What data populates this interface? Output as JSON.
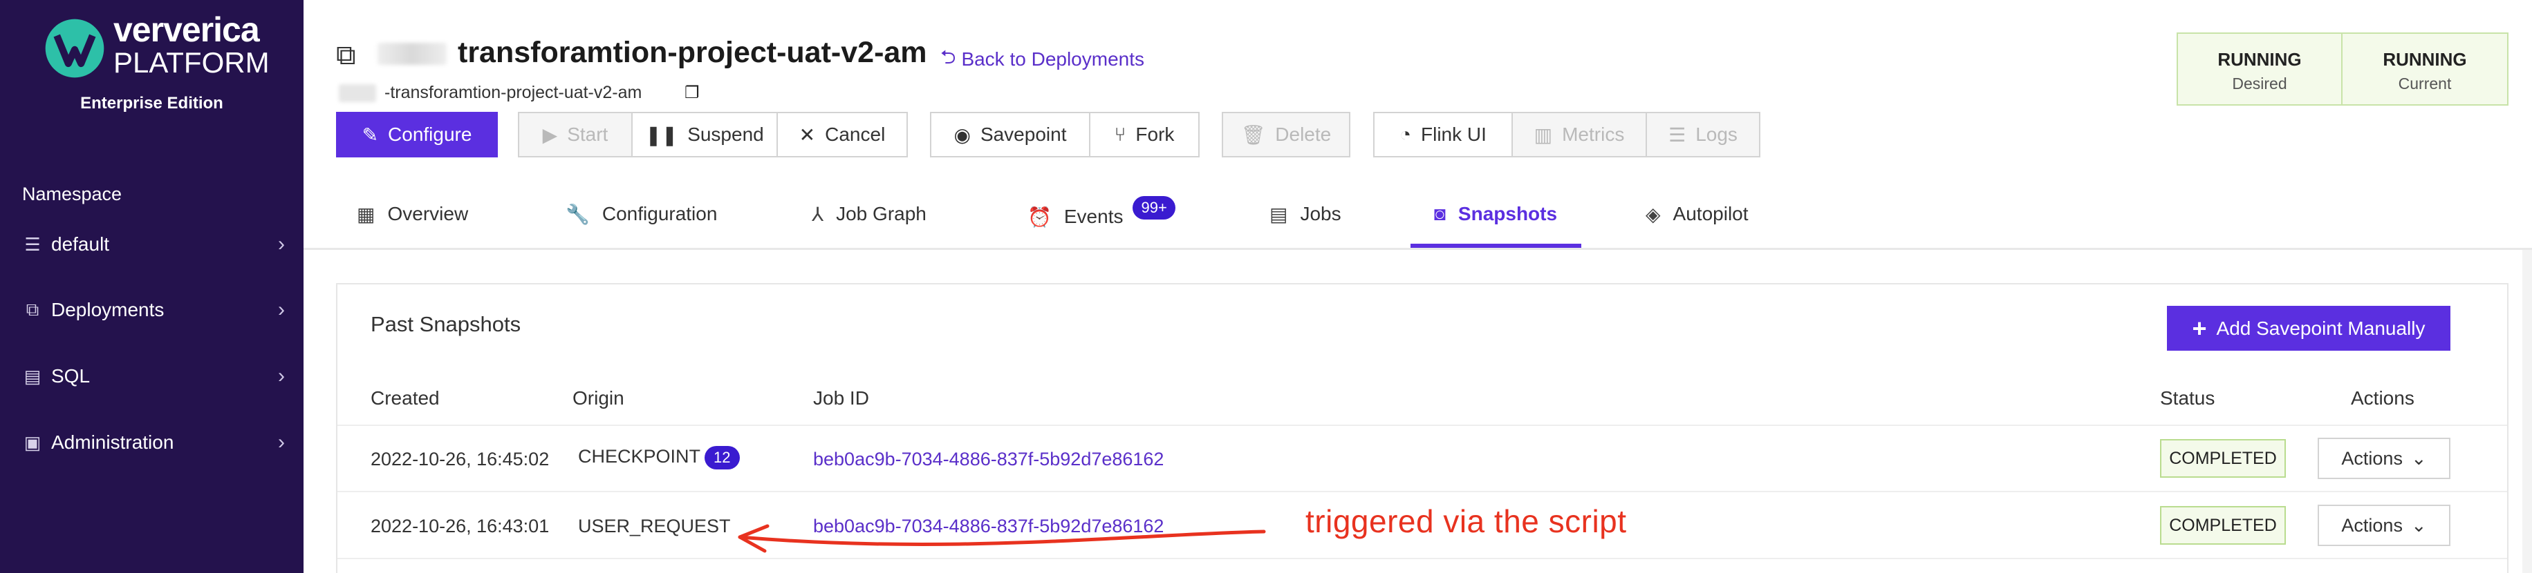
{
  "sidebar": {
    "brand_line1": "ververica",
    "brand_line2": "PLATFORM",
    "edition": "Enterprise Edition",
    "namespace_label": "Namespace",
    "items": [
      {
        "label": "default",
        "icon": "list-icon"
      },
      {
        "label": "Deployments",
        "icon": "deployments-icon"
      },
      {
        "label": "SQL",
        "icon": "sql-icon"
      },
      {
        "label": "Administration",
        "icon": "admin-icon"
      }
    ]
  },
  "header": {
    "title": "transforamtion-project-uat-v2-am",
    "back_link": "Back to Deployments",
    "subtitle": "-transforamtion-project-uat-v2-am",
    "status_desired": {
      "state": "RUNNING",
      "label": "Desired"
    },
    "status_current": {
      "state": "RUNNING",
      "label": "Current"
    }
  },
  "toolbar": {
    "configure": "Configure",
    "start": "Start",
    "suspend": "Suspend",
    "cancel": "Cancel",
    "savepoint": "Savepoint",
    "fork": "Fork",
    "delete": "Delete",
    "flink_ui": "Flink UI",
    "metrics": "Metrics",
    "logs": "Logs"
  },
  "tabs": {
    "overview": "Overview",
    "configuration": "Configuration",
    "job_graph": "Job Graph",
    "events": "Events",
    "events_badge": "99+",
    "jobs": "Jobs",
    "snapshots": "Snapshots",
    "autopilot": "Autopilot"
  },
  "panel": {
    "title": "Past Snapshots",
    "add_button": "Add Savepoint Manually",
    "columns": {
      "created": "Created",
      "origin": "Origin",
      "job_id": "Job ID",
      "status": "Status",
      "actions": "Actions"
    },
    "rows": [
      {
        "created": "2022-10-26, 16:45:02",
        "origin": "CHECKPOINT",
        "count": "12",
        "job_id": "beb0ac9b-7034-4886-837f-5b92d7e86162",
        "status": "COMPLETED",
        "actions": "Actions"
      },
      {
        "created": "2022-10-26, 16:43:01",
        "origin": "USER_REQUEST",
        "job_id": "beb0ac9b-7034-4886-837f-5b92d7e86162",
        "status": "COMPLETED",
        "actions": "Actions"
      }
    ]
  },
  "annotation": "triggered via the script",
  "colors": {
    "sidebar": "#24124d",
    "accent": "#5b2fe0",
    "annotation": "#e8321f",
    "status_bg": "#f4faea"
  }
}
